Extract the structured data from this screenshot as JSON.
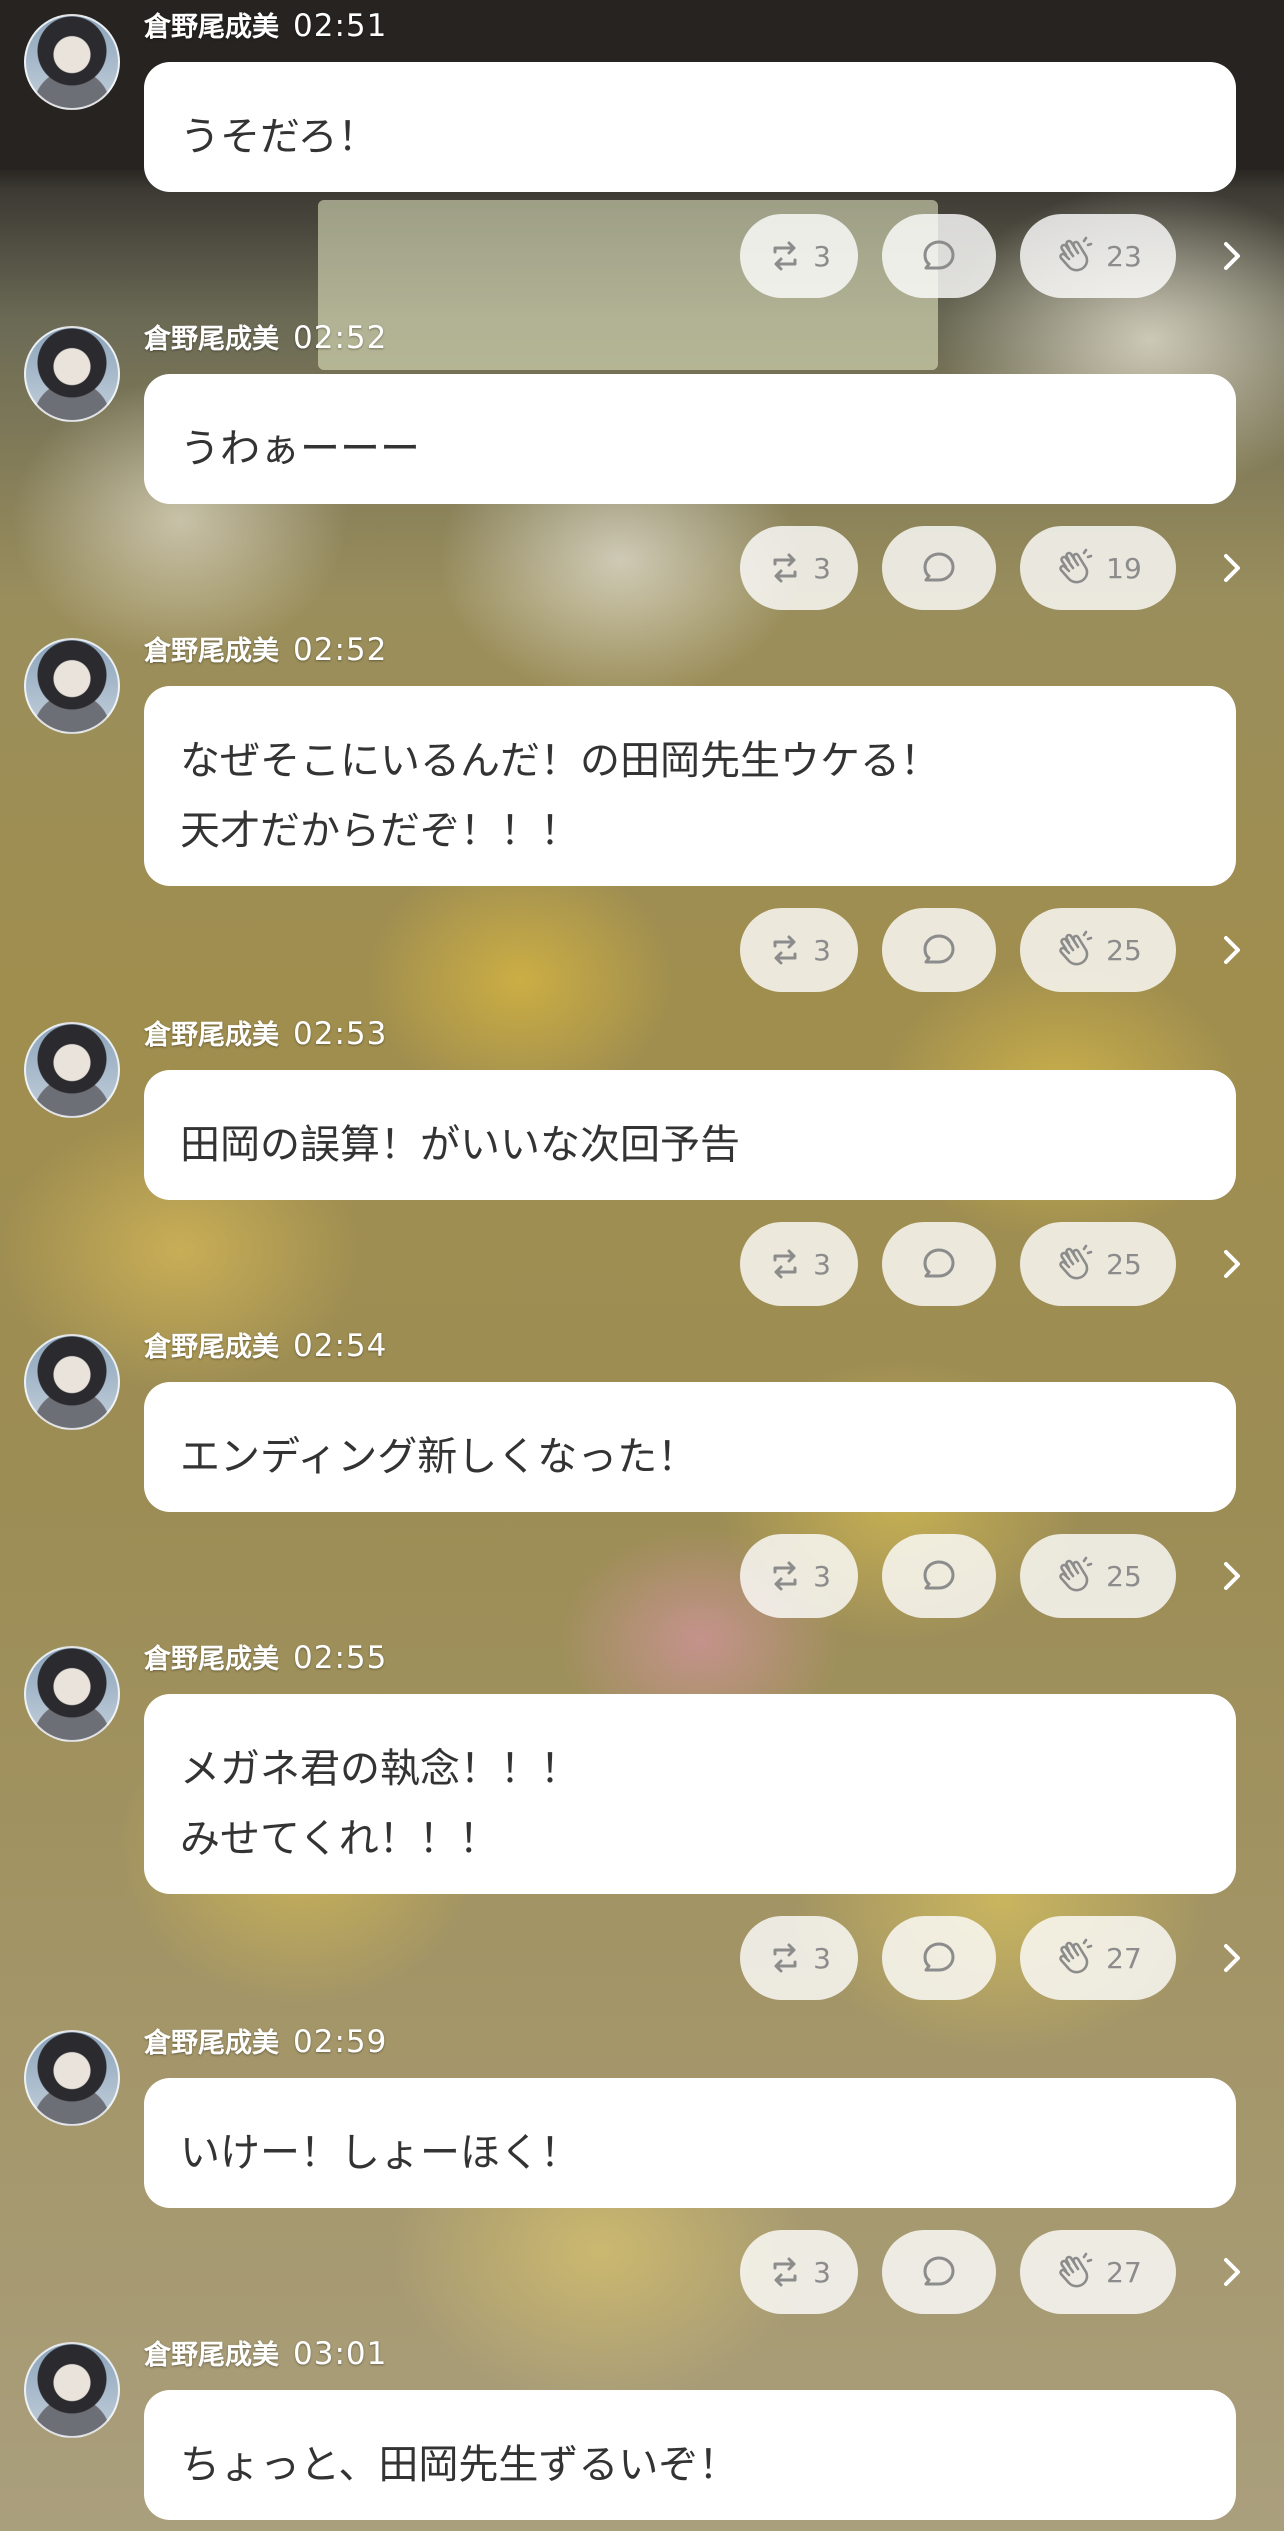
{
  "author_name": "倉野尾成美",
  "posts": [
    {
      "time": "02:51",
      "lines": [
        "うそだろ！"
      ],
      "shares": "3",
      "claps": "23"
    },
    {
      "time": "02:52",
      "lines": [
        "うわぁーーー"
      ],
      "shares": "3",
      "claps": "19"
    },
    {
      "time": "02:52",
      "lines": [
        "なぜそこにいるんだ！の田岡先生ウケる！",
        "天才だからだぞ！！！"
      ],
      "shares": "3",
      "claps": "25"
    },
    {
      "time": "02:53",
      "lines": [
        "田岡の誤算！がいいな次回予告"
      ],
      "shares": "3",
      "claps": "25"
    },
    {
      "time": "02:54",
      "lines": [
        "エンディング新しくなった！"
      ],
      "shares": "3",
      "claps": "25"
    },
    {
      "time": "02:55",
      "lines": [
        "メガネ君の執念！！！",
        "みせてくれ！！！"
      ],
      "shares": "3",
      "claps": "27"
    },
    {
      "time": "02:59",
      "lines": [
        "いけー！しょーほく！"
      ],
      "shares": "3",
      "claps": "27"
    },
    {
      "time": "03:01",
      "lines": [
        "ちょっと、田岡先生ずるいぞ！"
      ]
    }
  ],
  "icons": {
    "avatar": "avatar",
    "share": "share-icon",
    "comment": "comment-icon",
    "clap": "clap-icon",
    "next": "chevron-right-icon"
  },
  "colors": {
    "bubble": "#ffffff",
    "text": "#333333",
    "pill": "#ffffffcc",
    "pill_text": "#8c8c8c"
  }
}
